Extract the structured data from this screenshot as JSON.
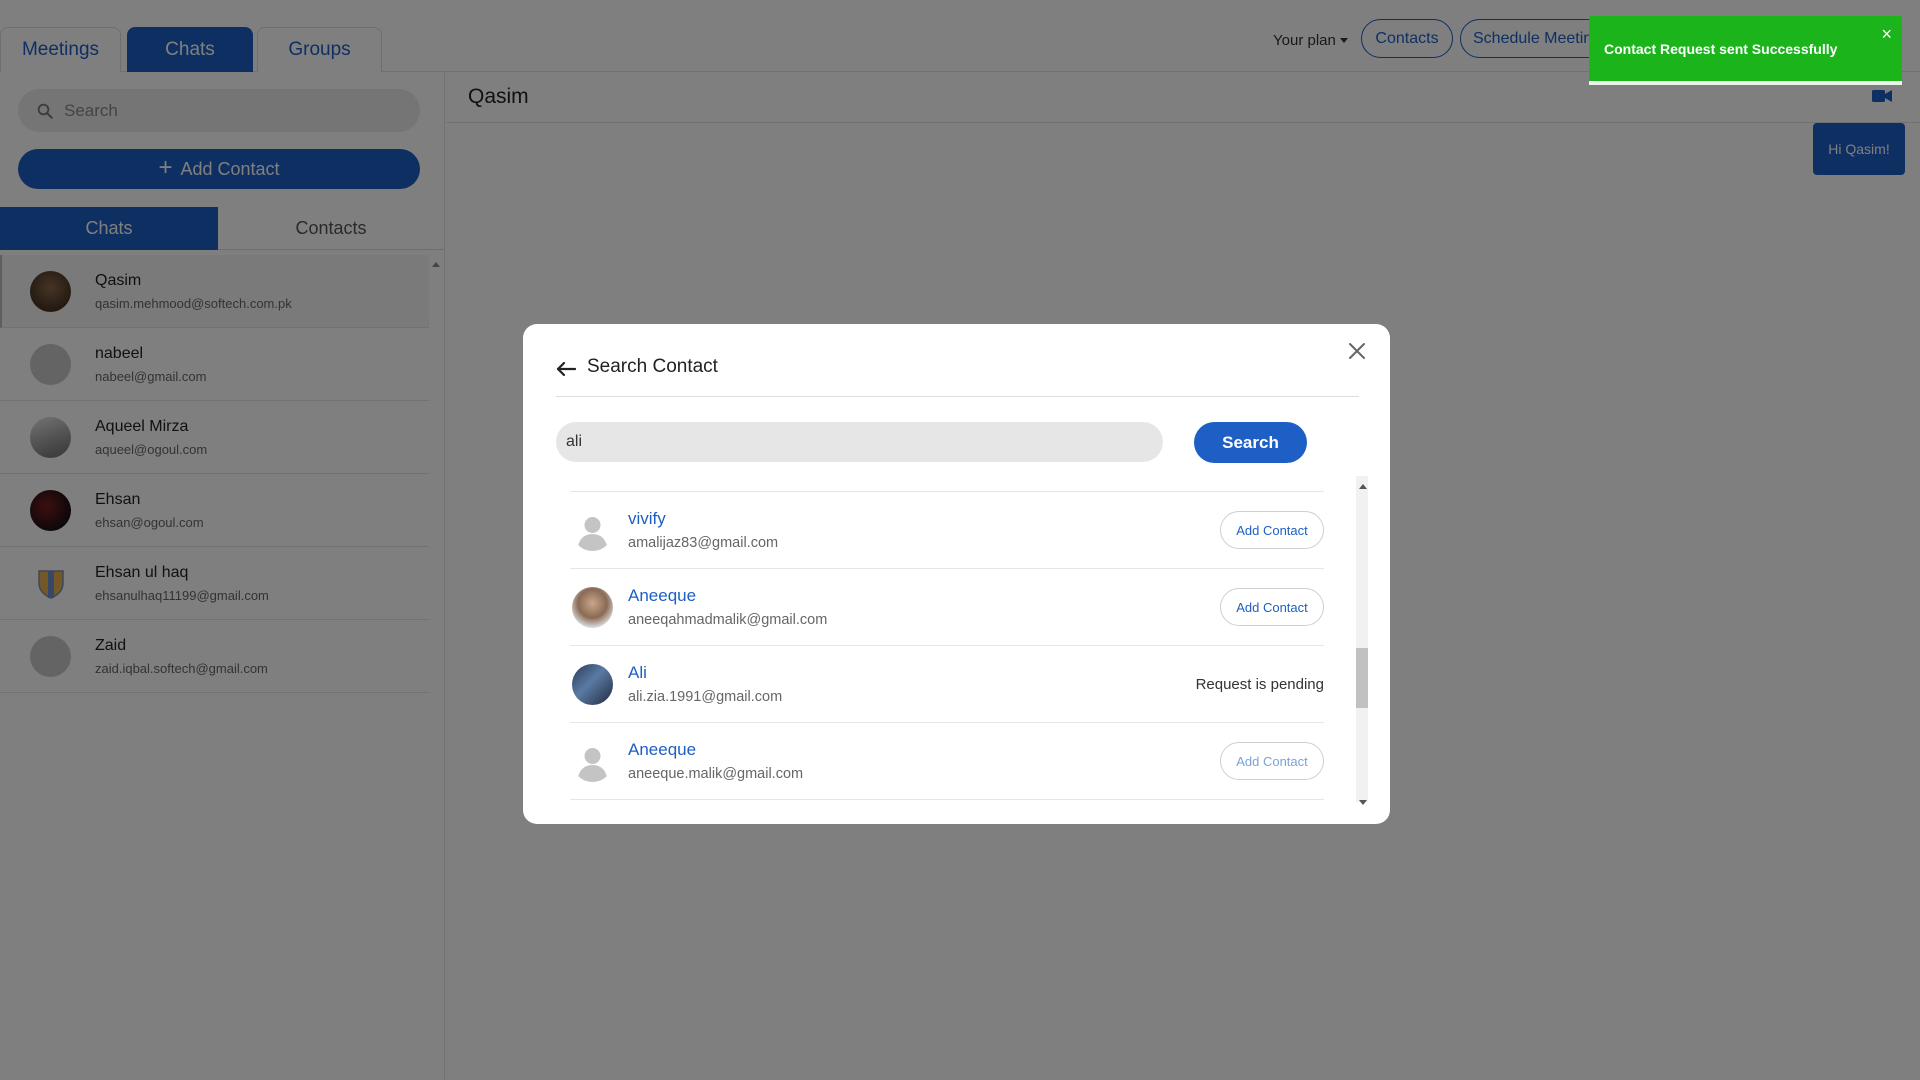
{
  "header": {
    "tabs": [
      {
        "label": "Meetings"
      },
      {
        "label": "Chats",
        "active": true
      },
      {
        "label": "Groups"
      }
    ],
    "plan_label": "Your plan",
    "contacts_button": "Contacts",
    "schedule_button": "Schedule Meeting"
  },
  "sidebar": {
    "search_placeholder": "Search",
    "add_contact_label": "Add Contact",
    "subtabs": [
      {
        "label": "Chats",
        "active": true
      },
      {
        "label": "Contacts"
      }
    ],
    "chats": [
      {
        "name": "Qasim",
        "email": "qasim.mehmood@softech.com.pk",
        "selected": true
      },
      {
        "name": "nabeel",
        "email": "nabeel@gmail.com"
      },
      {
        "name": "Aqueel Mirza",
        "email": "aqueel@ogoul.com"
      },
      {
        "name": "Ehsan",
        "email": "ehsan@ogoul.com"
      },
      {
        "name": "Ehsan ul haq",
        "email": "ehsanulhaq11199@gmail.com"
      },
      {
        "name": "Zaid",
        "email": "zaid.iqbal.softech@gmail.com"
      }
    ]
  },
  "chat": {
    "title": "Qasim",
    "message": "Hi Qasim!"
  },
  "toast": {
    "message": "Contact Request sent Successfully",
    "close_label": "×"
  },
  "modal": {
    "title": "Search Contact",
    "query": "ali",
    "search_button": "Search",
    "results": [
      {
        "name": "vivify",
        "email": "amalijaz83@gmail.com",
        "action": "Add Contact"
      },
      {
        "name": "Aneeque",
        "email": "aneeqahmadmalik@gmail.com",
        "action": "Add Contact"
      },
      {
        "name": "Ali",
        "email": "ali.zia.1991@gmail.com",
        "status": "Request is pending"
      },
      {
        "name": "Aneeque",
        "email": "aneeque.malik@gmail.com",
        "action": "Add Contact"
      }
    ]
  },
  "colors": {
    "primary": "#1d5fc4",
    "toast": "#1bb51b",
    "overlay": "rgba(0,0,0,0.5)"
  }
}
